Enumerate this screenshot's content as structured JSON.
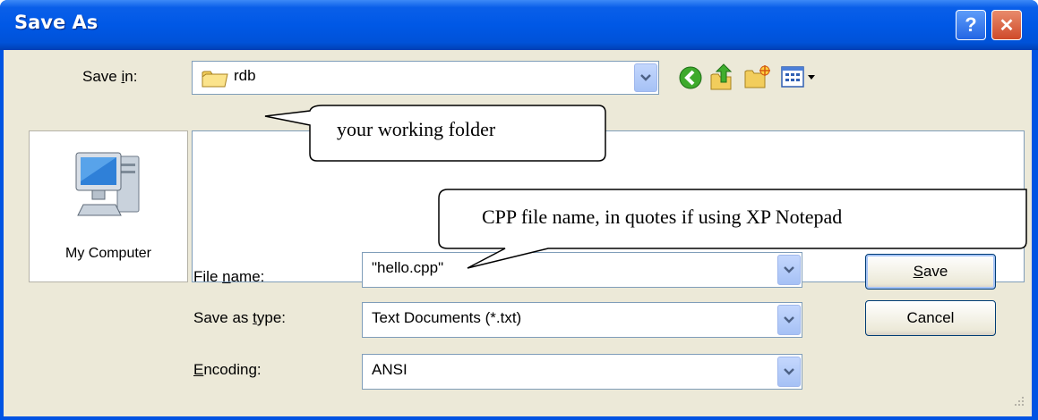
{
  "window": {
    "title": "Save As",
    "help_label": "?",
    "close_label": "✕"
  },
  "toolbar": {
    "save_in": {
      "prefix": "Save ",
      "mnemonic": "i",
      "suffix": "n:"
    },
    "folder_value": "rdb",
    "icons": [
      "back-icon",
      "up-folder-icon",
      "new-folder-icon",
      "view-menu-icon"
    ]
  },
  "places": {
    "items": [
      {
        "label": "My Computer",
        "icon": "my-computer-icon"
      }
    ]
  },
  "fields": {
    "file_name": {
      "prefix": "File ",
      "mnemonic": "n",
      "suffix": "ame:",
      "value": "\"hello.cpp\""
    },
    "save_as_type": {
      "prefix": "Save as ",
      "mnemonic": "t",
      "suffix": "ype:",
      "value": "Text Documents (*.txt)"
    },
    "encoding": {
      "prefix": "",
      "mnemonic": "E",
      "suffix": "ncoding:",
      "value": "ANSI"
    }
  },
  "buttons": {
    "save": {
      "mnemonic": "S",
      "suffix": "ave"
    },
    "cancel": "Cancel"
  },
  "callouts": {
    "working_folder": "your working folder",
    "file_name_note": "CPP file name, in quotes if using XP Notepad"
  },
  "colors": {
    "titlebar": "#0058e6",
    "dialog_face": "#ece9d8",
    "close_button": "#d8593a",
    "field_border": "#7f9db9"
  }
}
